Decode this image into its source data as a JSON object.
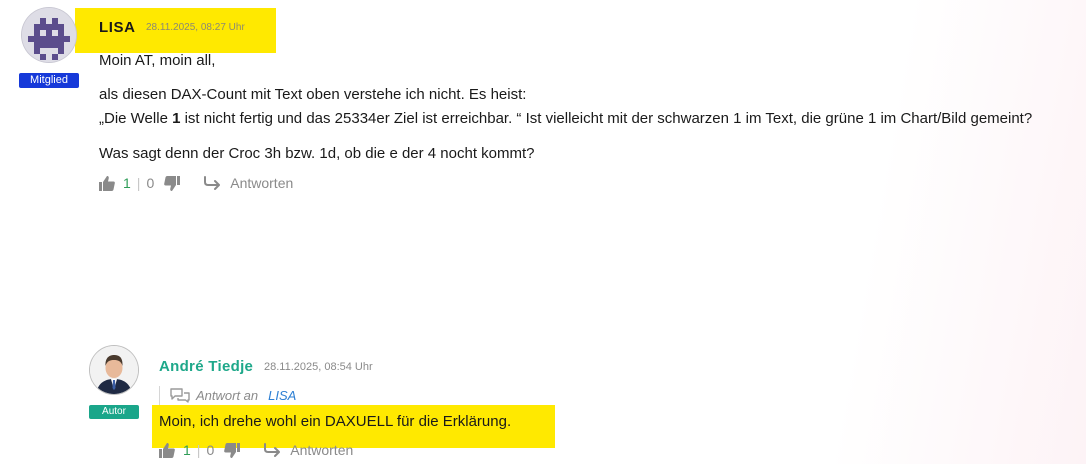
{
  "comment": {
    "author": "LISA",
    "date": "28.11.2025, 08:27 Uhr",
    "badge": "Mitglied",
    "lines": {
      "greeting": "Moin AT, moin all,",
      "line2": "als diesen DAX-Count mit Text oben verstehe ich nicht. Es heist:",
      "quote_start": "„Die Welle ",
      "quote_bold": "1",
      "quote_end": " ist nicht fertig und das 25334er Ziel ist erreichbar. “ Ist vielleicht mit der schwarzen 1 im Text, die grüne 1 im Chart/Bild gemeint?",
      "question": "Was sagt denn der Croc 3h bzw. 1d, ob die e der 4 nocht kommt?"
    },
    "votes": {
      "up": "1",
      "down": "0"
    },
    "reply_label": "Antworten"
  },
  "reply": {
    "author": "André Tiedje",
    "date": "28.11.2025, 08:54 Uhr",
    "badge": "Autor",
    "reply_to_label": "Antwort an",
    "reply_to_name": "LISA",
    "text": "Moin, ich drehe wohl ein DAXUELL für die Erklärung.",
    "votes": {
      "up": "1",
      "down": "0"
    },
    "reply_label": "Antworten"
  },
  "colors": {
    "highlight": "#ffe900",
    "member_badge": "#1639d9",
    "author_badge": "#1aa68a",
    "author_name": "#1ea88a",
    "upvote_count": "#2f9d58",
    "reply_to_link": "#2d7fd3"
  },
  "icons": {
    "avatar1": "pixel-invader-avatar",
    "avatar2": "portrait-avatar",
    "thumb_up": "thumbs-up-icon",
    "thumb_down": "thumbs-down-icon",
    "reply": "reply-arrow-icon",
    "reply_to": "chat-bubbles-icon"
  }
}
